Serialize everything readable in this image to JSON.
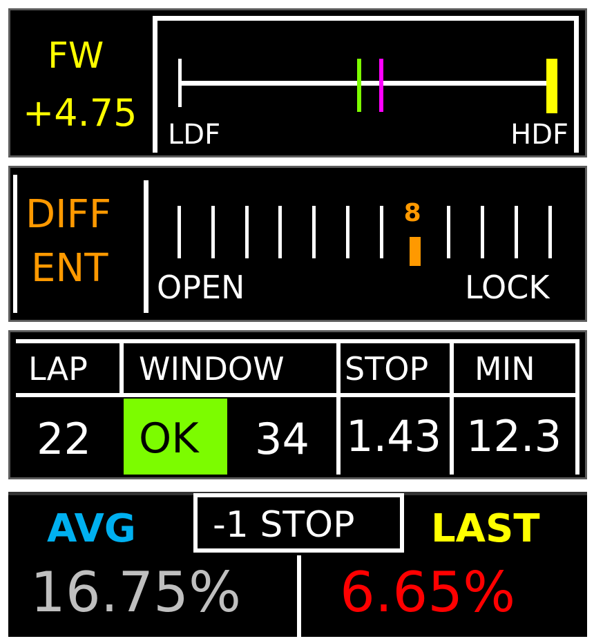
{
  "fw": {
    "label": "FW",
    "value": "+4.75",
    "low_label": "LDF",
    "high_label": "HDF",
    "green_marker": 0.48,
    "magenta_marker": 0.54,
    "current": 1.0,
    "label_color": "#ffff00",
    "green_color": "#7cfc00",
    "magenta_color": "#ff00ff",
    "current_color": "#ffff00"
  },
  "diff": {
    "label_line1": "DIFF",
    "label_line2": "ENT",
    "setting": "8",
    "left_label": "OPEN",
    "right_label": "LOCK",
    "total_positions": 12,
    "label_color": "#ff9900"
  },
  "strategy": {
    "headers": {
      "lap": "LAP",
      "window": "WINDOW",
      "stop": "STOP",
      "min": "MIN"
    },
    "values": {
      "lap": "22",
      "window_status": "OK",
      "window_lap": "34",
      "stop": "1.43",
      "min": "12.3"
    },
    "ok_color": "#7cfc00"
  },
  "wear": {
    "avg_label": "AVG",
    "stop_label": "-1 STOP",
    "last_label": "LAST",
    "avg_value": "16.75%",
    "last_value": "6.65%",
    "avg_label_color": "#00b0f0",
    "last_label_color": "#ffff00",
    "avg_value_color": "#bfbfbf",
    "last_value_color": "#ff0000"
  }
}
